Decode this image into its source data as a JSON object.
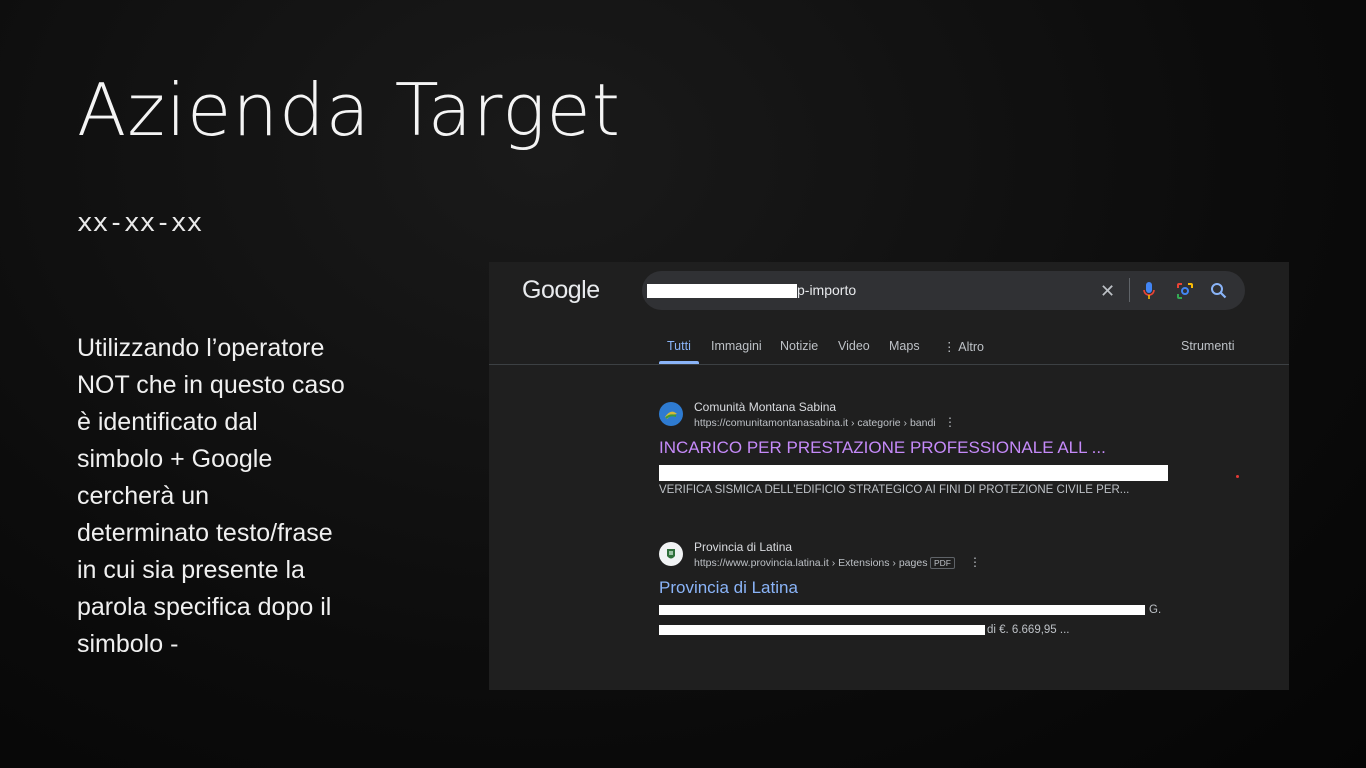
{
  "slide": {
    "title": "Azienda Target",
    "date": "xx-xx-xx",
    "body": "Utilizzando l’operatore NOT che in questo caso è identificato dal simbolo + Google cercherà un determinato testo/frase in cui sia presente la parola specifica dopo il simbolo -"
  },
  "screenshot": {
    "logo": "Google",
    "search": {
      "query_visible": "p-importo",
      "icons": [
        "close-icon",
        "microphone-icon",
        "lens-icon",
        "search-icon"
      ]
    },
    "tabs": [
      "Tutti",
      "Immagini",
      "Notizie",
      "Video",
      "Maps",
      "⋮ Altro"
    ],
    "tools_label": "Strumenti",
    "results": [
      {
        "site_name": "Comunità Montana Sabina",
        "url": "https://comunitamontanasabina.it › categorie › bandi",
        "title": "INCARICO PER PRESTAZIONE PROFESSIONALE ALL ...",
        "snippet_line2": "VERIFICA SISMICA DELL'EDIFICIO STRATEGICO AI FINI DI PROTEZIONE CIVILE PER..."
      },
      {
        "site_name": "Provincia di Latina",
        "url": "https://www.provincia.latina.it › Extensions › pages",
        "badge": "PDF",
        "title": "Provincia di Latina",
        "snippet_line1_end": "G.",
        "snippet_line2_end": "di €. 6.669,95 ..."
      }
    ],
    "colors": {
      "background": "#1f1f1f",
      "search_box": "#303134",
      "visited_link": "#c58af9",
      "link": "#8ab4f8"
    }
  }
}
